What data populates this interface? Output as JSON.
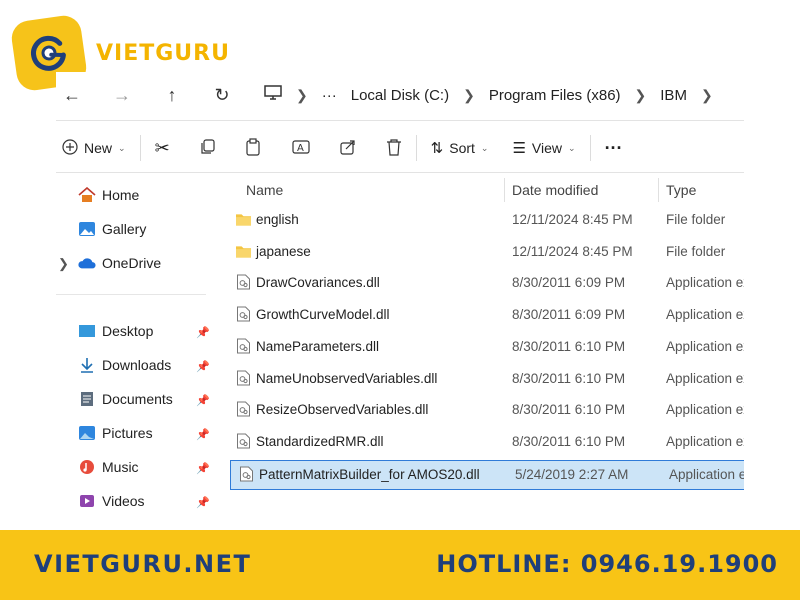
{
  "brand": {
    "name": "VIETGURU",
    "logo_icon": "vietguru-logo",
    "color": "#f4b400"
  },
  "nav": {
    "back_icon": "back-arrow-icon",
    "breadcrumb": [
      "Local Disk (C:)",
      "Program Files (x86)",
      "IBM"
    ],
    "overflow": "···"
  },
  "toolbar": {
    "new_label": "New",
    "sort_label": "Sort",
    "view_label": "View",
    "more": "···"
  },
  "sidebar": {
    "top": [
      {
        "label": "Home",
        "icon": "home-icon"
      },
      {
        "label": "Gallery",
        "icon": "gallery-icon"
      },
      {
        "label": "OneDrive",
        "icon": "onedrive-icon"
      }
    ],
    "pinned": [
      {
        "label": "Desktop",
        "icon": "desktop-icon"
      },
      {
        "label": "Downloads",
        "icon": "downloads-icon"
      },
      {
        "label": "Documents",
        "icon": "documents-icon"
      },
      {
        "label": "Pictures",
        "icon": "pictures-icon"
      },
      {
        "label": "Music",
        "icon": "music-icon"
      },
      {
        "label": "Videos",
        "icon": "videos-icon"
      }
    ]
  },
  "columns": {
    "name": "Name",
    "date": "Date modified",
    "type": "Type"
  },
  "files": [
    {
      "name": "english",
      "date": "12/11/2024 8:45 PM",
      "type": "File folder",
      "kind": "folder"
    },
    {
      "name": "japanese",
      "date": "12/11/2024 8:45 PM",
      "type": "File folder",
      "kind": "folder"
    },
    {
      "name": "DrawCovariances.dll",
      "date": "8/30/2011 6:09 PM",
      "type": "Application ex",
      "kind": "dll"
    },
    {
      "name": "GrowthCurveModel.dll",
      "date": "8/30/2011 6:09 PM",
      "type": "Application ex",
      "kind": "dll"
    },
    {
      "name": "NameParameters.dll",
      "date": "8/30/2011 6:10 PM",
      "type": "Application ex",
      "kind": "dll"
    },
    {
      "name": "NameUnobservedVariables.dll",
      "date": "8/30/2011 6:10 PM",
      "type": "Application ex",
      "kind": "dll"
    },
    {
      "name": "ResizeObservedVariables.dll",
      "date": "8/30/2011 6:10 PM",
      "type": "Application ex",
      "kind": "dll"
    },
    {
      "name": "StandardizedRMR.dll",
      "date": "8/30/2011 6:10 PM",
      "type": "Application ex",
      "kind": "dll"
    },
    {
      "name": "PatternMatrixBuilder_for AMOS20.dll",
      "date": "5/24/2019 2:27 AM",
      "type": "Application ex",
      "kind": "dll",
      "selected": true
    }
  ],
  "footer": {
    "site": "VIETGURU.NET",
    "hotline": "HOTLINE: 0946.19.1900",
    "bg": "#f8c416",
    "text_color": "#1f3f7a"
  }
}
